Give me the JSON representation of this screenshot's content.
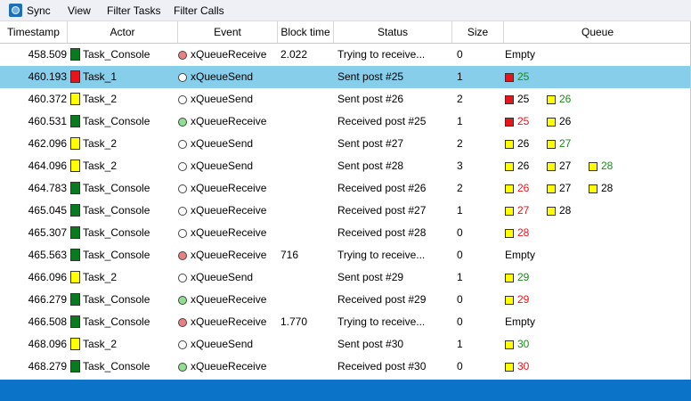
{
  "menu": {
    "sync_label": "Sync",
    "view_label": "View",
    "filter_tasks_label": "Filter Tasks",
    "filter_calls_label": "Filter Calls"
  },
  "columns": {
    "timestamp": "Timestamp",
    "actor": "Actor",
    "event": "Event",
    "block_time": "Block time",
    "status": "Status",
    "size": "Size",
    "queue": "Queue"
  },
  "colors": {
    "task_console": "#0a7a1f",
    "task_1": "#e8141a",
    "task_2": "#ffff00",
    "receive_wait": "#e88080",
    "receive_ok": "#8ee08e",
    "send": "#ffffff",
    "selected_row": "#87ceeb",
    "status_bar": "#0b74c8",
    "queue_text_new": "#1a8a1a",
    "queue_text_taken": "#e8141a",
    "queue_text_default": "#000000"
  },
  "rows": [
    {
      "timestamp": "458.509",
      "actor": "Task_Console",
      "actor_color": "#0a7a1f",
      "event": "xQueueReceive",
      "event_dot": "#e88080",
      "block_time": "2.022",
      "status": "Trying to receive...",
      "size": "0",
      "queue_empty": "Empty",
      "queue": []
    },
    {
      "timestamp": "460.193",
      "actor": "Task_1",
      "actor_color": "#e8141a",
      "event": "xQueueSend",
      "event_dot": "#ffffff",
      "block_time": "",
      "status": "Sent post #25",
      "size": "1",
      "queue_empty": "",
      "selected": true,
      "queue": [
        {
          "box": "#e8141a",
          "num": "25",
          "color": "#1a8a1a"
        }
      ]
    },
    {
      "timestamp": "460.372",
      "actor": "Task_2",
      "actor_color": "#ffff00",
      "event": "xQueueSend",
      "event_dot": "#ffffff",
      "block_time": "",
      "status": "Sent post #26",
      "size": "2",
      "queue_empty": "",
      "queue": [
        {
          "box": "#e8141a",
          "num": "25",
          "color": "#000000"
        },
        {
          "box": "#ffff00",
          "num": "26",
          "color": "#1a8a1a"
        }
      ]
    },
    {
      "timestamp": "460.531",
      "actor": "Task_Console",
      "actor_color": "#0a7a1f",
      "event": "xQueueReceive",
      "event_dot": "#8ee08e",
      "block_time": "",
      "status": "Received post #25",
      "size": "1",
      "queue_empty": "",
      "queue": [
        {
          "box": "#e8141a",
          "num": "25",
          "color": "#e8141a"
        },
        {
          "box": "#ffff00",
          "num": "26",
          "color": "#000000"
        }
      ]
    },
    {
      "timestamp": "462.096",
      "actor": "Task_2",
      "actor_color": "#ffff00",
      "event": "xQueueSend",
      "event_dot": "#ffffff",
      "block_time": "",
      "status": "Sent post #27",
      "size": "2",
      "queue_empty": "",
      "queue": [
        {
          "box": "#ffff00",
          "num": "26",
          "color": "#000000"
        },
        {
          "box": "#ffff00",
          "num": "27",
          "color": "#1a8a1a"
        }
      ]
    },
    {
      "timestamp": "464.096",
      "actor": "Task_2",
      "actor_color": "#ffff00",
      "event": "xQueueSend",
      "event_dot": "#ffffff",
      "block_time": "",
      "status": "Sent post #28",
      "size": "3",
      "queue_empty": "",
      "queue": [
        {
          "box": "#ffff00",
          "num": "26",
          "color": "#000000"
        },
        {
          "box": "#ffff00",
          "num": "27",
          "color": "#000000"
        },
        {
          "box": "#ffff00",
          "num": "28",
          "color": "#1a8a1a"
        }
      ]
    },
    {
      "timestamp": "464.783",
      "actor": "Task_Console",
      "actor_color": "#0a7a1f",
      "event": "xQueueReceive",
      "event_dot": "#ffffff",
      "block_time": "",
      "status": "Received post #26",
      "size": "2",
      "queue_empty": "",
      "queue": [
        {
          "box": "#ffff00",
          "num": "26",
          "color": "#e8141a"
        },
        {
          "box": "#ffff00",
          "num": "27",
          "color": "#000000"
        },
        {
          "box": "#ffff00",
          "num": "28",
          "color": "#000000"
        }
      ]
    },
    {
      "timestamp": "465.045",
      "actor": "Task_Console",
      "actor_color": "#0a7a1f",
      "event": "xQueueReceive",
      "event_dot": "#ffffff",
      "block_time": "",
      "status": "Received post #27",
      "size": "1",
      "queue_empty": "",
      "queue": [
        {
          "box": "#ffff00",
          "num": "27",
          "color": "#e8141a"
        },
        {
          "box": "#ffff00",
          "num": "28",
          "color": "#000000"
        }
      ]
    },
    {
      "timestamp": "465.307",
      "actor": "Task_Console",
      "actor_color": "#0a7a1f",
      "event": "xQueueReceive",
      "event_dot": "#ffffff",
      "block_time": "",
      "status": "Received post #28",
      "size": "0",
      "queue_empty": "",
      "queue": [
        {
          "box": "#ffff00",
          "num": "28",
          "color": "#e8141a"
        }
      ]
    },
    {
      "timestamp": "465.563",
      "actor": "Task_Console",
      "actor_color": "#0a7a1f",
      "event": "xQueueReceive",
      "event_dot": "#e88080",
      "block_time": "716",
      "status": "Trying to receive...",
      "size": "0",
      "queue_empty": "Empty",
      "queue": []
    },
    {
      "timestamp": "466.096",
      "actor": "Task_2",
      "actor_color": "#ffff00",
      "event": "xQueueSend",
      "event_dot": "#ffffff",
      "block_time": "",
      "status": "Sent post #29",
      "size": "1",
      "queue_empty": "",
      "queue": [
        {
          "box": "#ffff00",
          "num": "29",
          "color": "#1a8a1a"
        }
      ]
    },
    {
      "timestamp": "466.279",
      "actor": "Task_Console",
      "actor_color": "#0a7a1f",
      "event": "xQueueReceive",
      "event_dot": "#8ee08e",
      "block_time": "",
      "status": "Received post #29",
      "size": "0",
      "queue_empty": "",
      "queue": [
        {
          "box": "#ffff00",
          "num": "29",
          "color": "#e8141a"
        }
      ]
    },
    {
      "timestamp": "466.508",
      "actor": "Task_Console",
      "actor_color": "#0a7a1f",
      "event": "xQueueReceive",
      "event_dot": "#e88080",
      "block_time": "1.770",
      "status": "Trying to receive...",
      "size": "0",
      "queue_empty": "Empty",
      "queue": []
    },
    {
      "timestamp": "468.096",
      "actor": "Task_2",
      "actor_color": "#ffff00",
      "event": "xQueueSend",
      "event_dot": "#ffffff",
      "block_time": "",
      "status": "Sent post #30",
      "size": "1",
      "queue_empty": "",
      "queue": [
        {
          "box": "#ffff00",
          "num": "30",
          "color": "#1a8a1a"
        }
      ]
    },
    {
      "timestamp": "468.279",
      "actor": "Task_Console",
      "actor_color": "#0a7a1f",
      "event": "xQueueReceive",
      "event_dot": "#8ee08e",
      "block_time": "",
      "status": "Received post #30",
      "size": "0",
      "queue_empty": "",
      "queue": [
        {
          "box": "#ffff00",
          "num": "30",
          "color": "#e8141a"
        }
      ]
    }
  ]
}
